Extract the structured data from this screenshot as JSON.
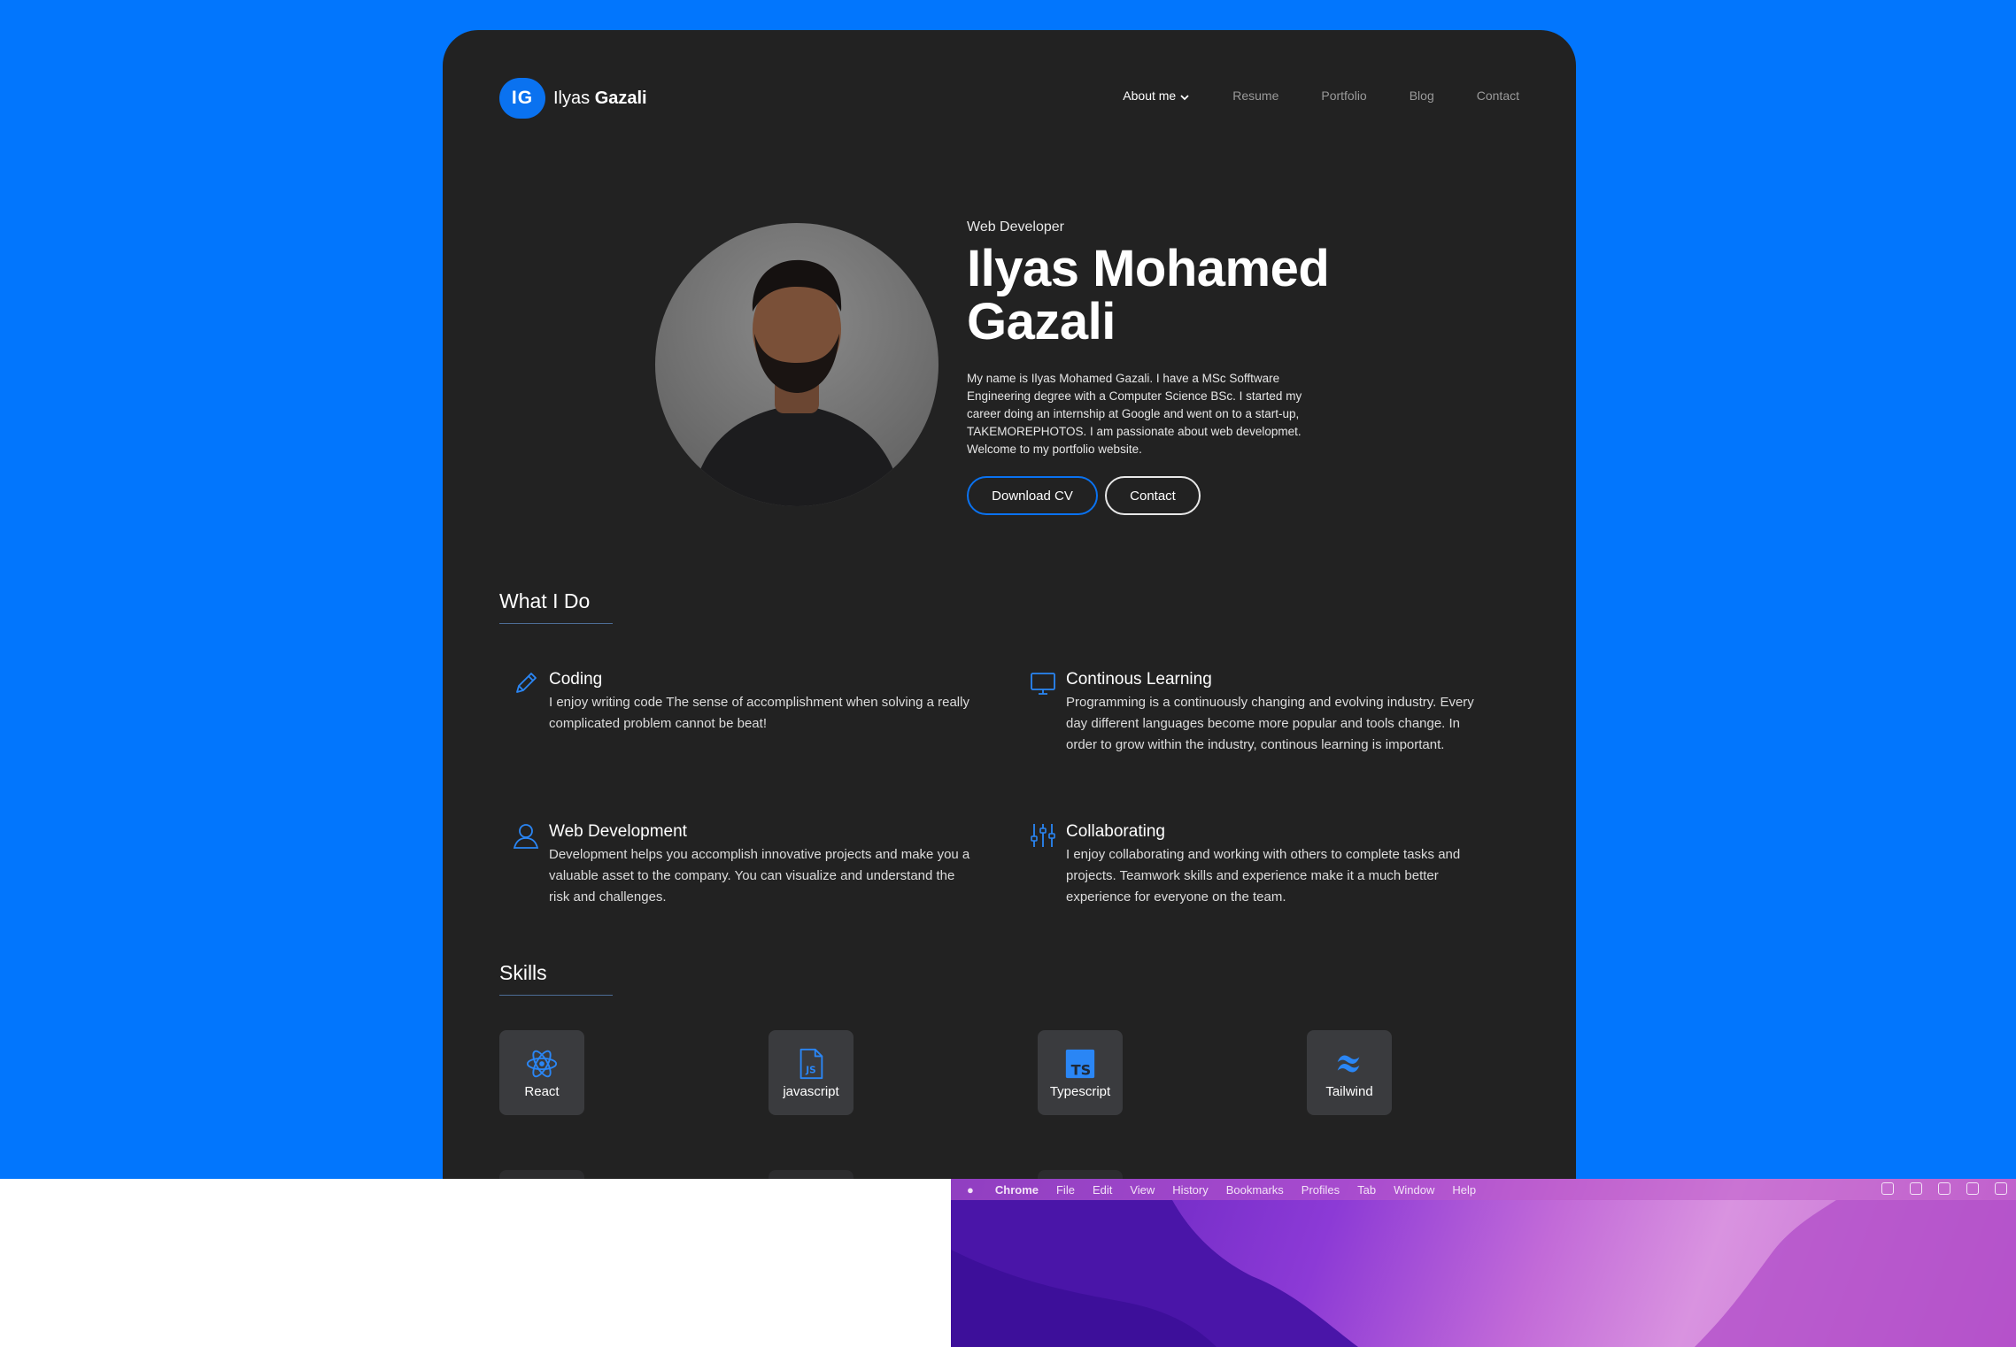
{
  "nav": {
    "logo_initials": "IG",
    "logo_first": "Ilyas",
    "logo_last": "Gazali",
    "items": [
      "About me",
      "Resume",
      "Portfolio",
      "Blog",
      "Contact"
    ]
  },
  "hero": {
    "role": "Web Developer",
    "name": "Ilyas Mohamed Gazali",
    "bio": "My name is Ilyas Mohamed Gazali. I have a MSc Sofftware Engineering degree with a Computer Science BSc. I started my career doing an internship at Google and went on to a start-up, TAKEMOREPHOTOS. I am passionate about web developmet. Welcome to my portfolio website.",
    "download_cv": "Download CV",
    "contact": "Contact"
  },
  "what_i_do": {
    "title": "What I Do",
    "items": [
      {
        "icon": "pencil-icon",
        "title": "Coding",
        "desc": "I enjoy writing code The sense of accomplishment when solving a really complicated problem cannot be beat!"
      },
      {
        "icon": "monitor-icon",
        "title": "Continous Learning",
        "desc": "Programming is a continuously changing and evolving industry. Every day different languages become more popular and tools change. In order to grow within the industry, continous learning is important."
      },
      {
        "icon": "user-icon",
        "title": "Web Development",
        "desc": "Development helps you accomplish innovative projects and make you a valuable asset to the company. You can visualize and understand the risk and challenges."
      },
      {
        "icon": "sliders-icon",
        "title": "Collaborating",
        "desc": "I enjoy collaborating and working with others to complete tasks and projects. Teamwork skills and experience make it a much better experience for everyone on the team."
      }
    ]
  },
  "skills": {
    "title": "Skills",
    "items": [
      {
        "icon": "react-icon",
        "label": "React"
      },
      {
        "icon": "javascript-icon",
        "label": "javascript"
      },
      {
        "icon": "typescript-icon",
        "label": "Typescript"
      },
      {
        "icon": "tailwind-icon",
        "label": "Tailwind"
      }
    ]
  },
  "menubar": {
    "app": "Chrome",
    "items": [
      "File",
      "Edit",
      "View",
      "History",
      "Bookmarks",
      "Profiles",
      "Tab",
      "Window",
      "Help"
    ]
  },
  "colors": {
    "background": "#0276fd",
    "card": "#222222",
    "accent": "#0a72f0"
  }
}
